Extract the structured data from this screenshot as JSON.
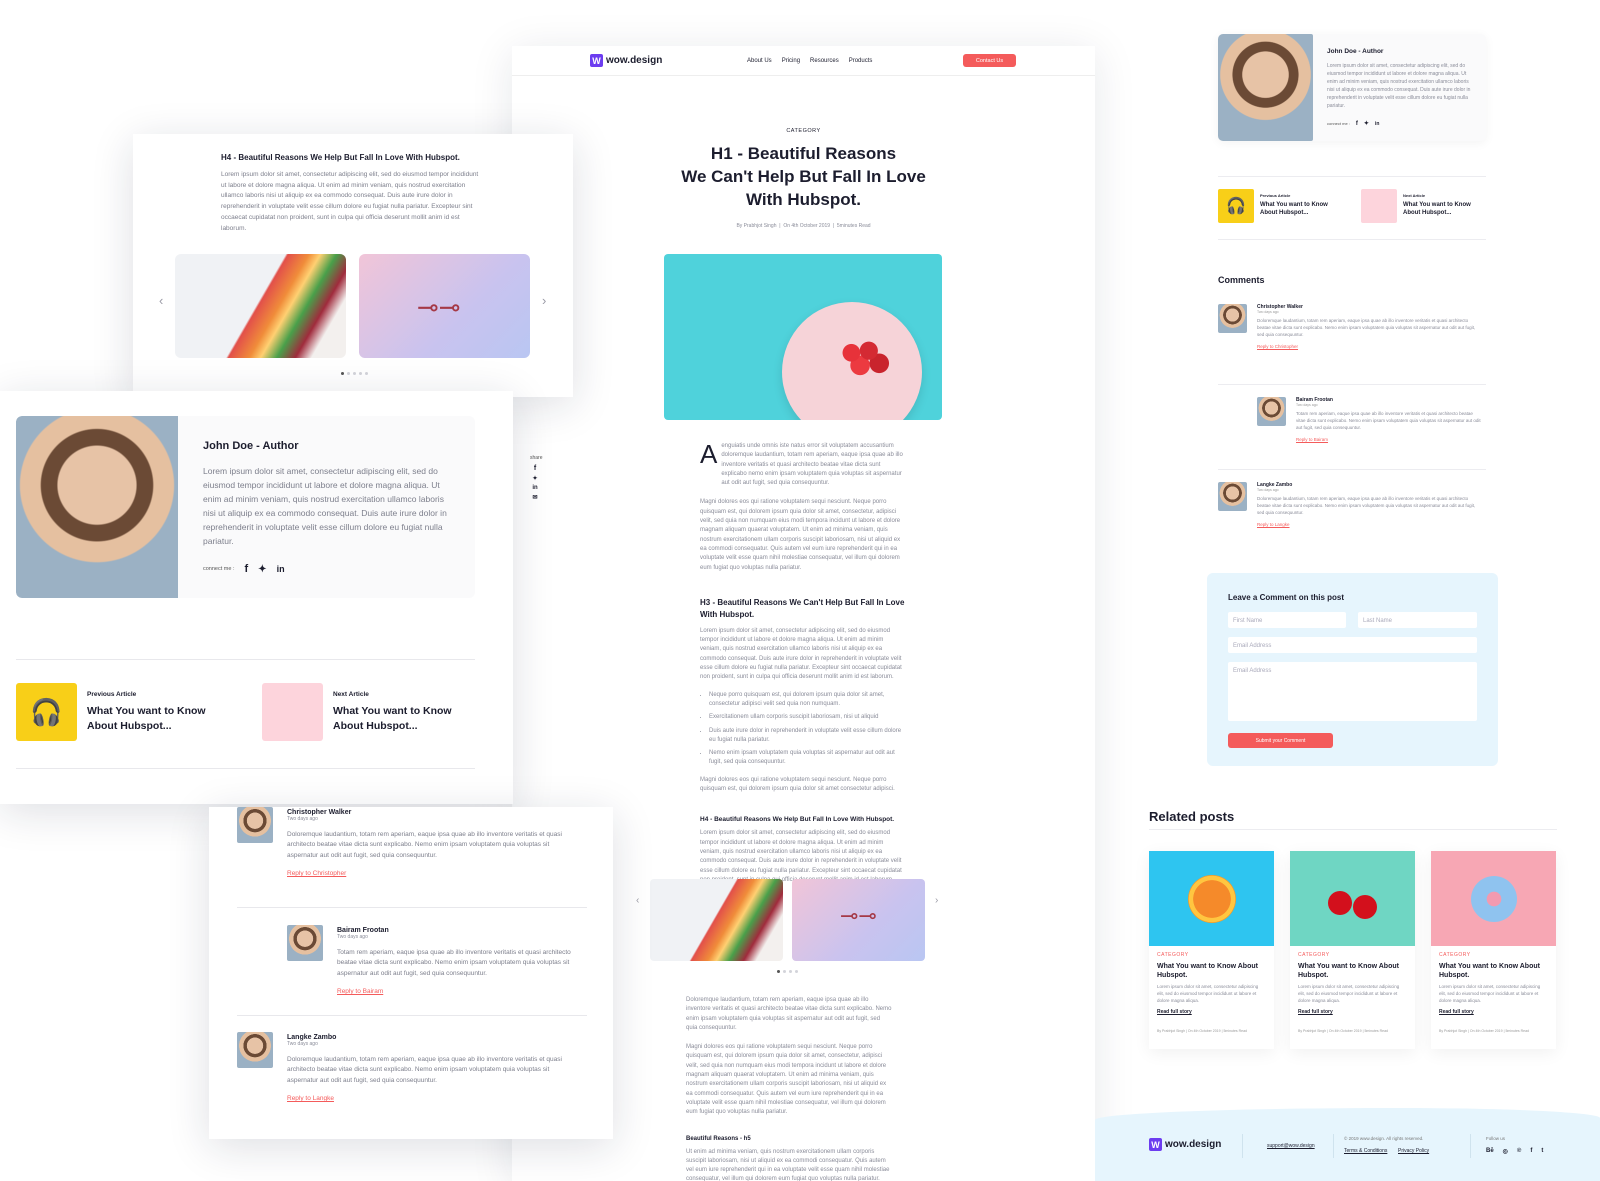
{
  "brand": {
    "name": "wow.design",
    "accent": "#f45b5b",
    "logo_color": "#6c3cf0"
  },
  "header": {
    "nav": [
      "About Us",
      "Pricing",
      "Resources",
      "Products"
    ],
    "cta": "Contact Us"
  },
  "post": {
    "category": "CATEGORY",
    "title_lines": [
      "H1 - Beautiful Reasons",
      "We Can't Help But Fall In Love",
      "With Hubspot."
    ],
    "meta": [
      "By Prabhjot Singh",
      "On 4th October 2019",
      "5minutes Read"
    ],
    "dropcap": "A",
    "intro": "enguiatis unde omnis iste natus error sit voluptatem accusantium doloremque laudantium, totam rem aperiam, eaque ipsa quae ab illo inventore veritatis et quasi architecto beatae vitae dicta sunt explicabo nemo enim ipsam voluptatem quia voluptas sit aspernatur aut odit aut fugit, sed quia consequuntur.",
    "para2": "Magni dolores eos qui ratione voluptatem sequi nesciunt. Neque porro quisquam est, qui dolorem ipsum quia dolor sit amet, consectetur, adipisci velit, sed quia non numquam eius modi tempora incidunt ut labore et dolore magnam aliquam quaerat voluptatem. Ut enim ad minima veniam, quis nostrum exercitationem ullam corporis suscipit laboriosam, nisi ut aliquid ex ea commodi consequatur. Quis autem vel eum iure reprehenderit qui in ea voluptate velit esse quam nihil molestiae consequatur, vel illum qui dolorem eum fugiat quo voluptas nulla pariatur.",
    "h3": "H3 - Beautiful Reasons We Can't Help But Fall In Love With Hubspot.",
    "h3_text": "Lorem ipsum dolor sit amet, consectetur adipiscing elit, sed do eiusmod tempor incididunt ut labore et dolore magna aliqua. Ut enim ad minim veniam, quis nostrud exercitation ullamco laboris nisi ut aliquip ex ea commodo consequat. Duis aute irure dolor in reprehenderit in voluptate velit esse cillum dolore eu fugiat nulla pariatur. Excepteur sint occaecat cupidatat non proident, sunt in culpa qui officia deserunt mollit anim id est laborum.",
    "bullets": [
      "Neque porro quisquam est, qui dolorem ipsum quia dolor sit amet, consectetur adipisci velit sed quia non numquam.",
      "Exercitationem ullam corporis suscipit laboriosam, nisi ut aliquid",
      "Duis aute irure dolor in reprehenderit in voluptate velit esse cillum dolore eu fugiat nulla pariatur.",
      "Nemo enim ipsam voluptatem quia voluptas sit aspernatur aut odit aut fugit, sed quia consequuntur."
    ],
    "after_bullets": "Magni dolores eos qui ratione voluptatem sequi nesciunt. Neque porro quisquam est, qui dolorem ipsum quia dolor sit amet consectetur adipisci.",
    "h4": "H4 - Beautiful Reasons We Help But Fall In Love With Hubspot.",
    "h4_text": "Lorem ipsum dolor sit amet, consectetur adipiscing elit, sed do eiusmod tempor incididunt ut labore et dolore magna aliqua. Ut enim ad minim veniam, quis nostrud exercitation ullamco laboris nisi ut aliquip ex ea commodo consequat. Duis aute irure dolor in reprehenderit in voluptate velit esse cillum dolore eu fugiat nulla pariatur. Excepteur sint occaecat cupidatat non proident, sunt in culpa qui officia deserunt mollit anim id est laborum.",
    "para3": "Doloremque laudantium, totam rem aperiam, eaque ipsa quae ab illo inventore veritatis et quasi architecto beatae vitae dicta sunt explicabo. Nemo enim ipsam voluptatem quia voluptas sit aspernatur aut odit aut fugit, sed quia consequuntur.",
    "para4": "Magni dolores eos qui ratione voluptatem sequi nesciunt. Neque porro quisquam est, qui dolorem ipsum quia dolor sit amet, consectetur, adipisci velit, sed quia non numquam eius modi tempora incidunt ut labore et dolore magnam aliquam quaerat voluptatem. Ut enim ad minima veniam, quis nostrum exercitationem ullam corporis suscipit laboriosam, nisi ut aliquid ex ea commodi consequatur. Quis autem vel eum iure reprehenderit qui in ea voluptate velit esse quam nihil molestiae consequatur, vel illum qui dolorem eum fugiat quo voluptas nulla pariatur.",
    "h5": "Beautiful Reasons - h5",
    "h5_text": "Ut enim ad minima veniam, quis nostrum exercitationem ullam corporis suscipit laboriosam, nisi ut aliquid ex ea commodi consequatur. Quis autem vel eum iure reprehenderit qui in ea voluptate velit esse quam nihil molestiae consequatur, vel illum qui dolorem eum fugiat quo voluptas nulla pariatur.",
    "share_label": "share"
  },
  "author": {
    "name": "John Doe - Author",
    "bio": "Lorem ipsum dolor sit amet, consectetur adipiscing elit, sed do eiusmod tempor incididunt ut labore et dolore magna aliqua. Ut enim ad minim veniam, quis nostrud exercitation ullamco laboris nisi ut aliquip ex ea commodo consequat. Duis aute irure dolor in reprehenderit in voluptate velit esse cillum dolore eu fugiat nulla pariatur.",
    "connect": "connect me :"
  },
  "articles": {
    "prev_label": "Previous Article",
    "next_label": "Next Article",
    "title": "What You want to Know About Hubspot..."
  },
  "comments": {
    "heading": "Comments",
    "items": [
      {
        "name": "Christopher Walker",
        "time": "Two days ago",
        "text": "Doloremque laudantium, totam rem aperiam, eaque ipsa quae ab illo inventore veritatis et quasi architecto beatae vitae dicta sunt explicabo. Nemo enim ipsam voluptatem quia voluptas sit aspernatur aut odit aut fugit, sed quia consequuntur.",
        "reply": "Reply to Christopher"
      },
      {
        "name": "Bairam Frootan",
        "time": "Two days ago",
        "text": "Totam rem aperiam, eaque ipsa quae ab illo inventore veritatis et quasi architecto beatae vitae dicta sunt explicabo. Nemo enim ipsam voluptatem quia voluptas sit aspernatur aut odit aut fugit, sed quia consequuntur.",
        "reply": "Reply to Bairam"
      },
      {
        "name": "Langke Zambo",
        "time": "Two days ago",
        "text": "Doloremque laudantium, totam rem aperiam, eaque ipsa quae ab illo inventore veritatis et quasi architecto beatae vitae dicta sunt explicabo. Nemo enim ipsam voluptatem quia voluptas sit aspernatur aut odit aut fugit, sed quia consequuntur.",
        "reply": "Reply to Langke"
      }
    ]
  },
  "form": {
    "title": "Leave a Comment on this post",
    "first_name": "First Name",
    "last_name": "Last Name",
    "email": "Email Address",
    "message": "Email Address",
    "submit": "Submit your Comment"
  },
  "related": {
    "heading": "Related posts",
    "category": "CATEGORY",
    "title": "What You want to Know About Hubspot.",
    "excerpt": "Lorem ipsum dolor sit amet, consectetur adipiscing elit, sed do eiusmod tempor incididunt ut labore et dolore magna aliqua.",
    "read": "Read full story",
    "meta": [
      "By Prabhjot Singh",
      "On 4th October 2019",
      "5minutes Read"
    ],
    "colors": [
      "#2ec5f0",
      "#6fd6c3",
      "#f7a7b4"
    ]
  },
  "footer": {
    "email": "support@wow.design",
    "copyright": "© 2019 www.design. All rights reserved.",
    "terms": "Terms & Conditions",
    "privacy": "Privacy Policy",
    "follow": "Follow us",
    "socials": [
      "Bē",
      "◎",
      "℗",
      "f",
      "t"
    ]
  }
}
